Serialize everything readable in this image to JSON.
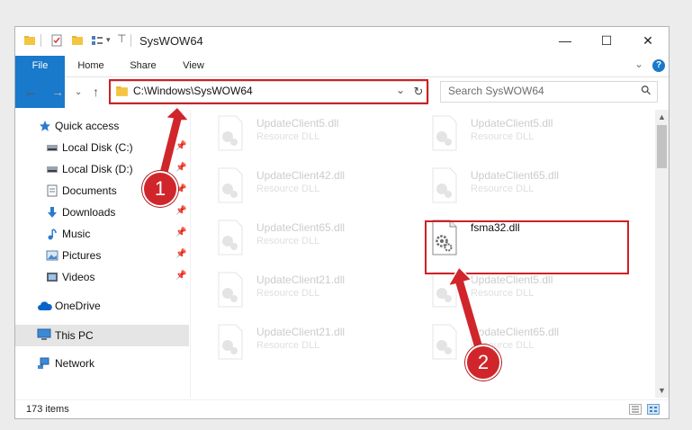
{
  "window": {
    "title": "SysWOW64",
    "controls": {
      "minimize": "—",
      "maximize": "☐",
      "close": "✕"
    }
  },
  "ribbon": {
    "tabs": [
      "File",
      "Home",
      "Share",
      "View"
    ],
    "expand_symbol": "⌄",
    "help_symbol": "?"
  },
  "navigation": {
    "back": "←",
    "forward": "→",
    "recent": "⌄",
    "up": "↑",
    "address": "C:\\Windows\\SysWOW64",
    "address_dropdown": "⌄",
    "refresh": "↻",
    "search_placeholder": "Search SysWOW64",
    "search_icon_glyph": "⚲"
  },
  "sidebar": {
    "items": [
      {
        "label": "Quick access",
        "icon": "star-icon",
        "pinned": false
      },
      {
        "label": "Local Disk (C:)",
        "icon": "drive-icon",
        "pinned": true
      },
      {
        "label": "Local Disk (D:)",
        "icon": "drive-icon",
        "pinned": true
      },
      {
        "label": "Documents",
        "icon": "documents-icon",
        "pinned": true
      },
      {
        "label": "Downloads",
        "icon": "download-icon",
        "pinned": true
      },
      {
        "label": "Music",
        "icon": "music-icon",
        "pinned": true
      },
      {
        "label": "Pictures",
        "icon": "pictures-icon",
        "pinned": true
      },
      {
        "label": "Videos",
        "icon": "videos-icon",
        "pinned": true
      },
      {
        "label": "OneDrive",
        "icon": "cloud-icon",
        "pinned": false
      },
      {
        "label": "This PC",
        "icon": "computer-icon",
        "pinned": false,
        "selected": true
      },
      {
        "label": "Network",
        "icon": "network-icon",
        "pinned": false
      }
    ],
    "pin_glyph": "📌"
  },
  "files": [
    {
      "name": "UpdateClient5.dll",
      "type": "Resource DLL",
      "faded": true
    },
    {
      "name": "UpdateClient5.dll",
      "type": "Resource DLL",
      "faded": true
    },
    {
      "name": "UpdateClient42.dll",
      "type": "Resource DLL",
      "faded": true
    },
    {
      "name": "UpdateClient65.dll",
      "type": "Resource DLL",
      "faded": true
    },
    {
      "name": "UpdateClient65.dll",
      "type": "Resource DLL",
      "faded": true
    },
    {
      "name": "fsma32.dll",
      "type": "",
      "faded": false,
      "highlighted": true
    },
    {
      "name": "UpdateClient21.dll",
      "type": "Resource DLL",
      "faded": true
    },
    {
      "name": "UpdateClient5.dll",
      "type": "Resource DLL",
      "faded": true
    },
    {
      "name": "UpdateClient21.dll",
      "type": "Resource DLL",
      "faded": true
    },
    {
      "name": "UpdateClient65.dll",
      "type": "Resource DLL",
      "faded": true
    }
  ],
  "status": {
    "item_count": "173 items"
  },
  "annotations": {
    "callout_1": "1",
    "callout_2": "2",
    "color": "#d0262b"
  },
  "colors": {
    "accent": "#1979ca",
    "highlight_box": "#cf2026"
  }
}
